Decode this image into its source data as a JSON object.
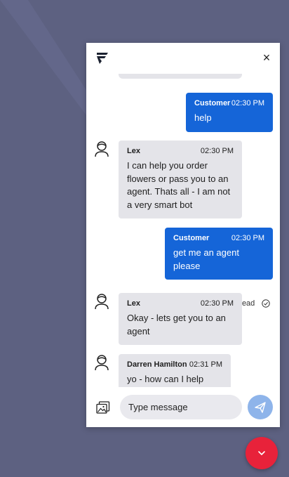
{
  "colors": {
    "background": "#5d6181",
    "customer_bubble": "#1565d8",
    "agent_bubble": "#e4e4e9",
    "send_button": "#8eb4ea",
    "fab": "#e8223a"
  },
  "header": {
    "logo_icon": "brand-flag-logo",
    "close_icon": "close-icon",
    "close_glyph": "×"
  },
  "messages": [
    {
      "sender": "Customer",
      "time": "02:30 PM",
      "text": "help",
      "direction": "outgoing"
    },
    {
      "sender": "Lex",
      "time": "02:30 PM",
      "text": "I can help you order flowers or pass you to an agent. Thats all - I am not a very smart bot",
      "direction": "incoming"
    },
    {
      "sender": "Customer",
      "time": "02:30 PM",
      "text": "get me an agent please",
      "direction": "outgoing"
    },
    {
      "sender": "Lex",
      "time": "02:30 PM",
      "text": "Okay - lets get you to an agent",
      "direction": "incoming"
    },
    {
      "sender": "Darren Hamilton",
      "time": "02:31 PM",
      "text": "yo - how can I help",
      "direction": "incoming"
    }
  ],
  "read_status": {
    "label": "Read",
    "icon": "check-circle-icon"
  },
  "composer": {
    "placeholder": "Type message",
    "attach_icon": "image-attachment-icon",
    "send_icon": "paper-plane-icon"
  },
  "fab": {
    "icon": "chevron-down-icon"
  }
}
